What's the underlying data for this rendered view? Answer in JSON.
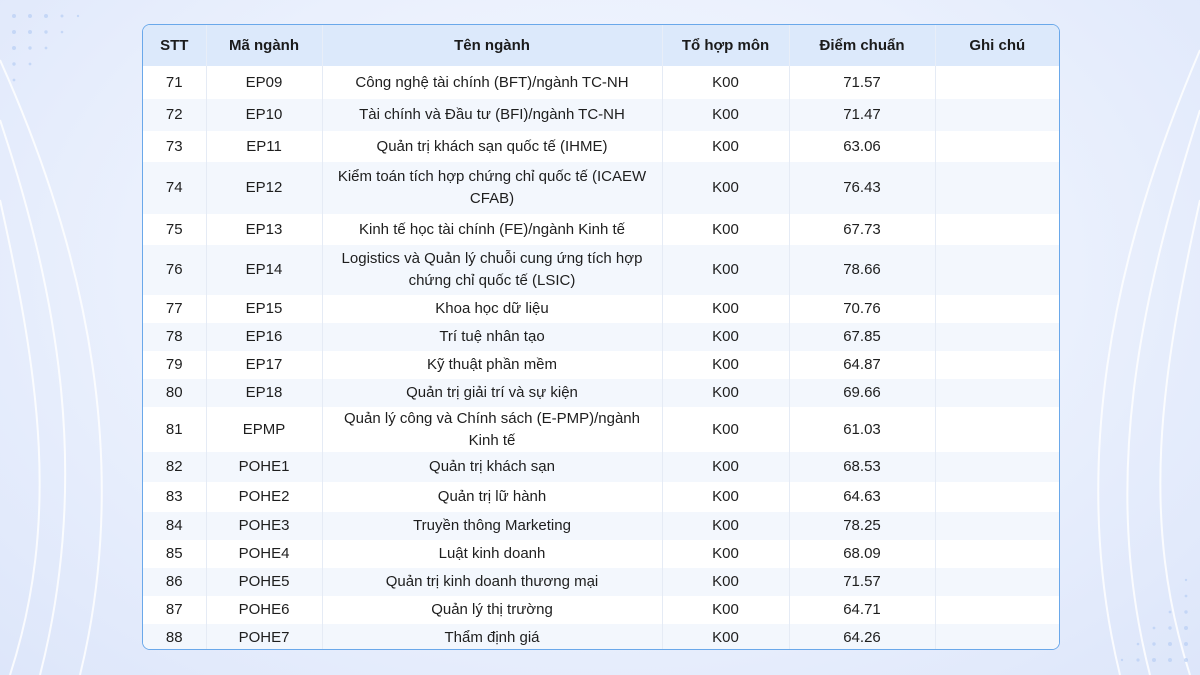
{
  "table": {
    "headers": [
      "STT",
      "Mã ngành",
      "Tên ngành",
      "Tổ hợp môn",
      "Điểm chuẩn",
      "Ghi chú"
    ],
    "rows": [
      [
        "71",
        "EP09",
        "Công nghệ tài chính (BFT)/ngành TC-NH",
        "K00",
        "71.57",
        ""
      ],
      [
        "72",
        "EP10",
        "Tài chính và Đầu tư (BFI)/ngành TC-NH",
        "K00",
        "71.47",
        ""
      ],
      [
        "73",
        "EP11",
        "Quản trị khách sạn quốc tế (IHME)",
        "K00",
        "63.06",
        ""
      ],
      [
        "74",
        "EP12",
        "Kiểm toán tích hợp chứng chỉ quốc tế (ICAEW CFAB)",
        "K00",
        "76.43",
        ""
      ],
      [
        "75",
        "EP13",
        "Kinh tế học tài chính (FE)/ngành Kinh tế",
        "K00",
        "67.73",
        ""
      ],
      [
        "76",
        "EP14",
        "Logistics và Quản lý chuỗi cung ứng tích hợp chứng chỉ quốc tế (LSIC)",
        "K00",
        "78.66",
        ""
      ],
      [
        "77",
        "EP15",
        "Khoa học dữ liệu",
        "K00",
        "70.76",
        ""
      ],
      [
        "78",
        "EP16",
        "Trí tuệ nhân tạo",
        "K00",
        "67.85",
        ""
      ],
      [
        "79",
        "EP17",
        "Kỹ thuật phần mềm",
        "K00",
        "64.87",
        ""
      ],
      [
        "80",
        "EP18",
        "Quản trị giải trí và sự kiện",
        "K00",
        "69.66",
        ""
      ],
      [
        "81",
        "EPMP",
        "Quản lý công và Chính sách (E-PMP)/ngành Kinh tế",
        "K00",
        "61.03",
        ""
      ],
      [
        "82",
        "POHE1",
        "Quản trị khách sạn",
        "K00",
        "68.53",
        ""
      ],
      [
        "83",
        "POHE2",
        "Quản trị lữ hành",
        "K00",
        "64.63",
        ""
      ],
      [
        "84",
        "POHE3",
        "Truyền thông Marketing",
        "K00",
        "78.25",
        ""
      ],
      [
        "85",
        "POHE4",
        "Luật kinh doanh",
        "K00",
        "68.09",
        ""
      ],
      [
        "86",
        "POHE5",
        "Quản trị kinh doanh thương mại",
        "K00",
        "71.57",
        ""
      ],
      [
        "87",
        "POHE6",
        "Quản lý thị trường",
        "K00",
        "64.71",
        ""
      ],
      [
        "88",
        "POHE7",
        "Thẩm định giá",
        "K00",
        "64.26",
        ""
      ]
    ]
  },
  "colors": {
    "header_bg": "#dce9fb",
    "border": "#6aa8ea",
    "row_alt_bg": "#f3f7fd"
  }
}
